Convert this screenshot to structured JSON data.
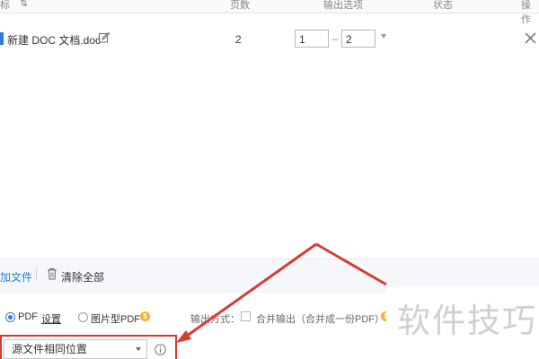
{
  "header": {
    "col_name": "标",
    "col_sort": "⇅",
    "col_pages": "页数",
    "col_output": "输出选项",
    "col_status": "状态",
    "col_action": "操作"
  },
  "file_row": {
    "filename": "新建 DOC 文档.doc",
    "pages": "2",
    "page_from": "1",
    "range_sep": "–",
    "page_to": "2"
  },
  "toolbar": {
    "add_files": "加文件",
    "clear_all": "清除全部"
  },
  "output": {
    "pdf_label": "PDF",
    "settings_link": "设置",
    "image_pdf_label": "图片型PDF",
    "coin_glyph": "$",
    "merge_mode_label": "输出方式：",
    "merge_option": "合并输出（合并成一份PDF）"
  },
  "destination": {
    "selected": "源文件相同位置"
  },
  "watermark": {
    "text": "软件技巧"
  },
  "colors": {
    "accent": "#2f7bd8",
    "annotation_red": "#d93a34",
    "coin": "#f0b428"
  }
}
